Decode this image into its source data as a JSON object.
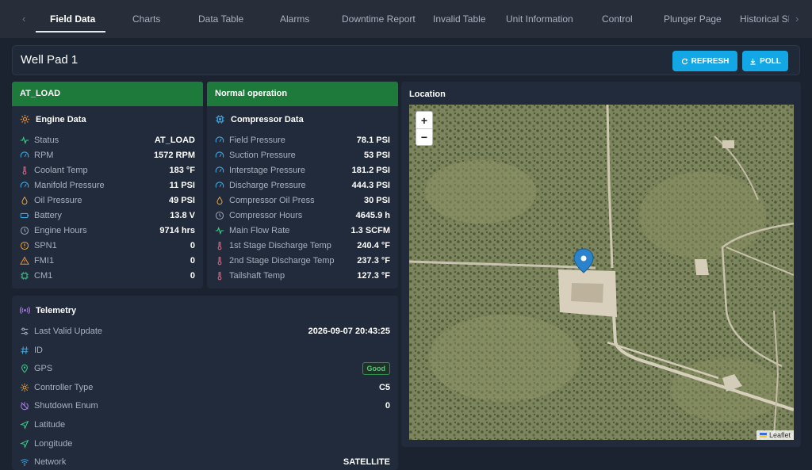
{
  "nav": {
    "tabs": [
      {
        "label": "Field Data"
      },
      {
        "label": "Charts"
      },
      {
        "label": "Data Table"
      },
      {
        "label": "Alarms"
      },
      {
        "label": "Downtime Report"
      },
      {
        "label": "Invalid Table"
      },
      {
        "label": "Unit Information"
      },
      {
        "label": "Control"
      },
      {
        "label": "Plunger Page"
      },
      {
        "label": "Historical SF"
      }
    ],
    "active_tab": "Field Data"
  },
  "header": {
    "title": "Well Pad 1",
    "refresh_label": "REFRESH",
    "poll_label": "POLL"
  },
  "engine": {
    "status_banner": "AT_LOAD",
    "title": "Engine Data",
    "rows": [
      {
        "label": "Status",
        "value": "AT_LOAD",
        "icon": "pulse-icon"
      },
      {
        "label": "RPM",
        "value": "1572 RPM",
        "icon": "gauge-icon"
      },
      {
        "label": "Coolant Temp",
        "value": "183 °F",
        "icon": "thermometer-icon"
      },
      {
        "label": "Manifold Pressure",
        "value": "11 PSI",
        "icon": "gauge-icon"
      },
      {
        "label": "Oil Pressure",
        "value": "49 PSI",
        "icon": "oil-icon"
      },
      {
        "label": "Battery",
        "value": "13.8 V",
        "icon": "battery-icon"
      },
      {
        "label": "Engine Hours",
        "value": "9714 hrs",
        "icon": "clock-icon"
      },
      {
        "label": "SPN1",
        "value": "0",
        "icon": "alert-circle-icon"
      },
      {
        "label": "FMI1",
        "value": "0",
        "icon": "warning-triangle-icon"
      },
      {
        "label": "CM1",
        "value": "0",
        "icon": "chip-icon"
      }
    ]
  },
  "compressor": {
    "status_banner": "Normal operation",
    "title": "Compressor Data",
    "rows": [
      {
        "label": "Field Pressure",
        "value": "78.1 PSI",
        "icon": "gauge-icon"
      },
      {
        "label": "Suction Pressure",
        "value": "53 PSI",
        "icon": "gauge-icon"
      },
      {
        "label": "Interstage Pressure",
        "value": "181.2 PSI",
        "icon": "gauge-icon"
      },
      {
        "label": "Discharge Pressure",
        "value": "444.3 PSI",
        "icon": "gauge-icon"
      },
      {
        "label": "Compressor Oil Press",
        "value": "30 PSI",
        "icon": "oil-icon"
      },
      {
        "label": "Compressor Hours",
        "value": "4645.9 h",
        "icon": "clock-icon"
      },
      {
        "label": "Main Flow Rate",
        "value": "1.3 SCFM",
        "icon": "pulse-icon"
      },
      {
        "label": "1st Stage Discharge Temp",
        "value": "240.4 °F",
        "icon": "thermometer-icon"
      },
      {
        "label": "2nd Stage Discharge Temp",
        "value": "237.3 °F",
        "icon": "thermometer-icon"
      },
      {
        "label": "Tailshaft Temp",
        "value": "127.3 °F",
        "icon": "thermometer-icon"
      }
    ]
  },
  "telemetry": {
    "title": "Telemetry",
    "rows": [
      {
        "label": "Last Valid Update",
        "value": "2026-09-07 20:43:25",
        "icon": "sliders-icon"
      },
      {
        "label": "ID",
        "value": "",
        "icon": "hash-icon"
      },
      {
        "label": "GPS",
        "value": "Good",
        "icon": "map-pin-icon"
      },
      {
        "label": "Controller Type",
        "value": "C5",
        "icon": "gear-icon"
      },
      {
        "label": "Shutdown Enum",
        "value": "0",
        "icon": "power-off-icon"
      },
      {
        "label": "Latitude",
        "value": "",
        "icon": "navigation-icon"
      },
      {
        "label": "Longitude",
        "value": "",
        "icon": "navigation-icon"
      },
      {
        "label": "Network",
        "value": "SATELLITE",
        "icon": "wifi-icon"
      }
    ]
  },
  "location": {
    "title": "Location",
    "zoom_in": "+",
    "zoom_out": "−",
    "attribution": "Leaflet"
  },
  "colors": {
    "status_green": "#1d7a3b",
    "accent_blue": "#14a7e6",
    "good_green": "#56c77c"
  }
}
